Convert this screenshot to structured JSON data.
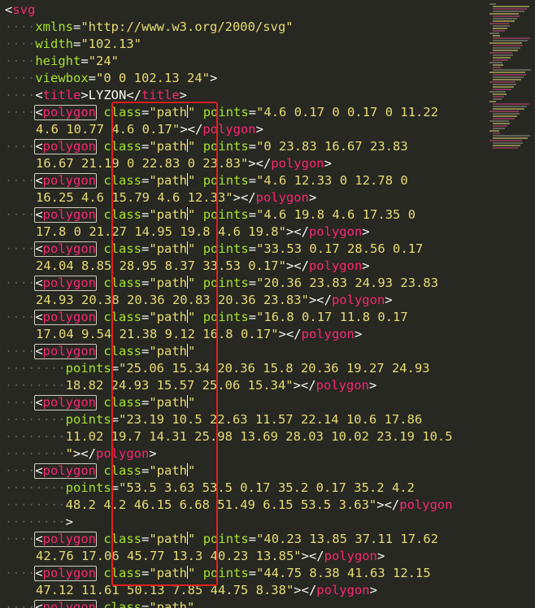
{
  "editor": {
    "lines": [
      {
        "dots": "",
        "parts": [
          {
            "t": "<",
            "c": "punct"
          },
          {
            "t": "svg",
            "c": "tag"
          }
        ]
      },
      {
        "dots": "····",
        "parts": [
          {
            "t": "xmlns",
            "c": "attr"
          },
          {
            "t": "=",
            "c": "punct"
          },
          {
            "t": "\"http://www.w3.org/2000/svg\"",
            "c": "str"
          }
        ]
      },
      {
        "dots": "····",
        "parts": [
          {
            "t": "width",
            "c": "attr"
          },
          {
            "t": "=",
            "c": "punct"
          },
          {
            "t": "\"102.13\"",
            "c": "str"
          }
        ]
      },
      {
        "dots": "····",
        "parts": [
          {
            "t": "height",
            "c": "attr"
          },
          {
            "t": "=",
            "c": "punct"
          },
          {
            "t": "\"24\"",
            "c": "str"
          }
        ]
      },
      {
        "dots": "····",
        "parts": [
          {
            "t": "viewbox",
            "c": "attr"
          },
          {
            "t": "=",
            "c": "punct"
          },
          {
            "t": "\"0 0 102.13 24\"",
            "c": "str"
          },
          {
            "t": ">",
            "c": "punct"
          }
        ]
      },
      {
        "dots": "····",
        "parts": [
          {
            "t": "<",
            "c": "punct"
          },
          {
            "t": "title",
            "c": "tag"
          },
          {
            "t": ">LYZON</",
            "c": "punct"
          },
          {
            "t": "title",
            "c": "tag"
          },
          {
            "t": ">",
            "c": "punct"
          }
        ]
      },
      {
        "dots": "····",
        "box": "<polygon",
        "parts": [
          {
            "t": " ",
            "c": "punct"
          },
          {
            "t": "class",
            "c": "attr"
          },
          {
            "t": "=",
            "c": "punct"
          },
          {
            "t": "\"path\"",
            "c": "str",
            "cursor": true
          },
          {
            "t": " ",
            "c": "punct"
          },
          {
            "t": "points",
            "c": "attr"
          },
          {
            "t": "=",
            "c": "punct"
          },
          {
            "t": "\"4.6 0.17 0 0.17 0 11.22",
            "c": "str"
          }
        ]
      },
      {
        "dots": "",
        "parts": [
          {
            "t": "4.6 10.77 4.6 0.17\"",
            "c": "str"
          },
          {
            "t": "></",
            "c": "punct"
          },
          {
            "t": "polygon",
            "c": "tag"
          },
          {
            "t": ">",
            "c": "punct"
          }
        ]
      },
      {
        "dots": "····",
        "box": "<polygon",
        "parts": [
          {
            "t": " ",
            "c": "punct"
          },
          {
            "t": "class",
            "c": "attr"
          },
          {
            "t": "=",
            "c": "punct"
          },
          {
            "t": "\"path\"",
            "c": "str",
            "cursor": true
          },
          {
            "t": " ",
            "c": "punct"
          },
          {
            "t": "points",
            "c": "attr"
          },
          {
            "t": "=",
            "c": "punct"
          },
          {
            "t": "\"0 23.83 16.67 23.83",
            "c": "str"
          }
        ]
      },
      {
        "dots": "",
        "parts": [
          {
            "t": "16.67 21.19 0 22.83 0 23.83\"",
            "c": "str"
          },
          {
            "t": "></",
            "c": "punct"
          },
          {
            "t": "polygon",
            "c": "tag"
          },
          {
            "t": ">",
            "c": "punct"
          }
        ]
      },
      {
        "dots": "····",
        "box": "<polygon",
        "parts": [
          {
            "t": " ",
            "c": "punct"
          },
          {
            "t": "class",
            "c": "attr"
          },
          {
            "t": "=",
            "c": "punct"
          },
          {
            "t": "\"path\"",
            "c": "str",
            "cursor": true
          },
          {
            "t": " ",
            "c": "punct"
          },
          {
            "t": "points",
            "c": "attr"
          },
          {
            "t": "=",
            "c": "punct"
          },
          {
            "t": "\"4.6 12.33 0 12.78 0",
            "c": "str"
          }
        ]
      },
      {
        "dots": "",
        "parts": [
          {
            "t": "16.25 4.6 15.79 4.6 12.33\"",
            "c": "str"
          },
          {
            "t": "></",
            "c": "punct"
          },
          {
            "t": "polygon",
            "c": "tag"
          },
          {
            "t": ">",
            "c": "punct"
          }
        ]
      },
      {
        "dots": "····",
        "box": "<polygon",
        "parts": [
          {
            "t": " ",
            "c": "punct"
          },
          {
            "t": "class",
            "c": "attr"
          },
          {
            "t": "=",
            "c": "punct"
          },
          {
            "t": "\"path\"",
            "c": "str",
            "cursor": true
          },
          {
            "t": " ",
            "c": "punct"
          },
          {
            "t": "points",
            "c": "attr"
          },
          {
            "t": "=",
            "c": "punct"
          },
          {
            "t": "\"4.6 19.8 4.6 17.35 0",
            "c": "str"
          }
        ]
      },
      {
        "dots": "",
        "parts": [
          {
            "t": "17.8 0 21.27 14.95 19.8 4.6 19.8\"",
            "c": "str"
          },
          {
            "t": "></",
            "c": "punct"
          },
          {
            "t": "polygon",
            "c": "tag"
          },
          {
            "t": ">",
            "c": "punct"
          }
        ]
      },
      {
        "dots": "····",
        "box": "<polygon",
        "parts": [
          {
            "t": " ",
            "c": "punct"
          },
          {
            "t": "class",
            "c": "attr"
          },
          {
            "t": "=",
            "c": "punct"
          },
          {
            "t": "\"path\"",
            "c": "str",
            "cursor": true
          },
          {
            "t": " ",
            "c": "punct"
          },
          {
            "t": "points",
            "c": "attr"
          },
          {
            "t": "=",
            "c": "punct"
          },
          {
            "t": "\"33.53 0.17 28.56 0.17",
            "c": "str"
          }
        ]
      },
      {
        "dots": "",
        "parts": [
          {
            "t": "24.04 8.85 28.95 8.37 33.53 0.17\"",
            "c": "str"
          },
          {
            "t": "></",
            "c": "punct"
          },
          {
            "t": "polygon",
            "c": "tag"
          },
          {
            "t": ">",
            "c": "punct"
          }
        ]
      },
      {
        "dots": "····",
        "box": "<polygon",
        "parts": [
          {
            "t": " ",
            "c": "punct"
          },
          {
            "t": "class",
            "c": "attr"
          },
          {
            "t": "=",
            "c": "punct"
          },
          {
            "t": "\"path\"",
            "c": "str",
            "cursor": true
          },
          {
            "t": " ",
            "c": "punct"
          },
          {
            "t": "points",
            "c": "attr"
          },
          {
            "t": "=",
            "c": "punct"
          },
          {
            "t": "\"20.36 23.83 24.93 23.83",
            "c": "str"
          }
        ]
      },
      {
        "dots": "",
        "parts": [
          {
            "t": "24.93 20.38 20.36 20.83 20.36 23.83\"",
            "c": "str"
          },
          {
            "t": "></",
            "c": "punct"
          },
          {
            "t": "polygon",
            "c": "tag"
          },
          {
            "t": ">",
            "c": "punct"
          }
        ]
      },
      {
        "dots": "····",
        "box": "<polygon",
        "parts": [
          {
            "t": " ",
            "c": "punct"
          },
          {
            "t": "class",
            "c": "attr"
          },
          {
            "t": "=",
            "c": "punct"
          },
          {
            "t": "\"path\"",
            "c": "str",
            "cursor": true
          },
          {
            "t": " ",
            "c": "punct"
          },
          {
            "t": "points",
            "c": "attr"
          },
          {
            "t": "=",
            "c": "punct"
          },
          {
            "t": "\"16.8 0.17 11.8 0.17",
            "c": "str"
          }
        ]
      },
      {
        "dots": "",
        "parts": [
          {
            "t": "17.04 9.54 21.38 9.12 16.8 0.17\"",
            "c": "str"
          },
          {
            "t": "></",
            "c": "punct"
          },
          {
            "t": "polygon",
            "c": "tag"
          },
          {
            "t": ">",
            "c": "punct"
          }
        ]
      },
      {
        "dots": "····",
        "box": "<polygon",
        "parts": [
          {
            "t": " ",
            "c": "punct"
          },
          {
            "t": "class",
            "c": "attr"
          },
          {
            "t": "=",
            "c": "punct"
          },
          {
            "t": "\"path\"",
            "c": "str",
            "cursor": true
          }
        ]
      },
      {
        "dots": "········",
        "parts": [
          {
            "t": "points",
            "c": "attr"
          },
          {
            "t": "=",
            "c": "punct"
          },
          {
            "t": "\"25.06 15.34 20.36 15.8 20.36 19.27 24.93",
            "c": "str"
          }
        ]
      },
      {
        "dots": "········",
        "parts": [
          {
            "t": "18.82 24.93 15.57 25.06 15.34\"",
            "c": "str"
          },
          {
            "t": "></",
            "c": "punct"
          },
          {
            "t": "polygon",
            "c": "tag"
          },
          {
            "t": ">",
            "c": "punct"
          }
        ]
      },
      {
        "dots": "····",
        "box": "<polygon",
        "parts": [
          {
            "t": " ",
            "c": "punct"
          },
          {
            "t": "class",
            "c": "attr"
          },
          {
            "t": "=",
            "c": "punct"
          },
          {
            "t": "\"path\"",
            "c": "str",
            "cursor": true
          }
        ]
      },
      {
        "dots": "········",
        "parts": [
          {
            "t": "points",
            "c": "attr"
          },
          {
            "t": "=",
            "c": "punct"
          },
          {
            "t": "\"23.19 10.5 22.63 11.57 22.14 10.6 17.86",
            "c": "str"
          }
        ]
      },
      {
        "dots": "········",
        "parts": [
          {
            "t": "11.02 19.7 14.31 25.98 13.69 28.03 10.02 23.19 10.5",
            "c": "str"
          }
        ]
      },
      {
        "dots": "········",
        "parts": [
          {
            "t": "\"",
            "c": "str"
          },
          {
            "t": "></",
            "c": "punct"
          },
          {
            "t": "polygon",
            "c": "tag"
          },
          {
            "t": ">",
            "c": "punct"
          }
        ]
      },
      {
        "dots": "····",
        "box": "<polygon",
        "parts": [
          {
            "t": " ",
            "c": "punct"
          },
          {
            "t": "class",
            "c": "attr"
          },
          {
            "t": "=",
            "c": "punct"
          },
          {
            "t": "\"path\"",
            "c": "str",
            "cursor": true
          }
        ]
      },
      {
        "dots": "········",
        "parts": [
          {
            "t": "points",
            "c": "attr"
          },
          {
            "t": "=",
            "c": "punct"
          },
          {
            "t": "\"53.5 3.63 53.5 0.17 35.2 0.17 35.2 4.2",
            "c": "str"
          }
        ]
      },
      {
        "dots": "········",
        "parts": [
          {
            "t": "48.2 4.2 46.15 6.68 51.49 6.15 53.5 3.63\"",
            "c": "str"
          },
          {
            "t": "></",
            "c": "punct"
          },
          {
            "t": "polygon",
            "c": "tag"
          }
        ]
      },
      {
        "dots": "········",
        "parts": [
          {
            "t": ">",
            "c": "punct"
          }
        ]
      },
      {
        "dots": "····",
        "box": "<polygon",
        "parts": [
          {
            "t": " ",
            "c": "punct"
          },
          {
            "t": "class",
            "c": "attr"
          },
          {
            "t": "=",
            "c": "punct"
          },
          {
            "t": "\"path\"",
            "c": "str",
            "cursor": true
          },
          {
            "t": " ",
            "c": "punct"
          },
          {
            "t": "points",
            "c": "attr"
          },
          {
            "t": "=",
            "c": "punct"
          },
          {
            "t": "\"40.23 13.85 37.11 17.62",
            "c": "str"
          }
        ]
      },
      {
        "dots": "",
        "parts": [
          {
            "t": "42.76 17.06 45.77 13.3 40.23 13.85\"",
            "c": "str"
          },
          {
            "t": "></",
            "c": "punct"
          },
          {
            "t": "polygon",
            "c": "tag"
          },
          {
            "t": ">",
            "c": "punct"
          }
        ]
      },
      {
        "dots": "····",
        "box": "<polygon",
        "parts": [
          {
            "t": " ",
            "c": "punct"
          },
          {
            "t": "class",
            "c": "attr"
          },
          {
            "t": "=",
            "c": "punct"
          },
          {
            "t": "\"path\"",
            "c": "str",
            "cursor": true
          },
          {
            "t": " ",
            "c": "punct"
          },
          {
            "t": "points",
            "c": "attr"
          },
          {
            "t": "=",
            "c": "punct"
          },
          {
            "t": "\"44.75 8.38 41.63 12.15",
            "c": "str"
          }
        ]
      },
      {
        "dots": "",
        "parts": [
          {
            "t": "47.12 11.61 50.13 7.85 44.75 8.38\"",
            "c": "str"
          },
          {
            "t": "></",
            "c": "punct"
          },
          {
            "t": "polygon",
            "c": "tag"
          },
          {
            "t": ">",
            "c": "punct"
          }
        ]
      },
      {
        "dots": "····",
        "box": "<polygon",
        "parts": [
          {
            "t": " ",
            "c": "punct"
          },
          {
            "t": "class",
            "c": "attr"
          },
          {
            "t": "=",
            "c": "punct"
          },
          {
            "t": "\"path\"",
            "c": "str"
          }
        ]
      }
    ]
  },
  "colors": {
    "background": "#272822",
    "tag": "#f92672",
    "attribute": "#a6e22e",
    "string": "#e6db74",
    "highlight_frame": "#e0201e"
  }
}
